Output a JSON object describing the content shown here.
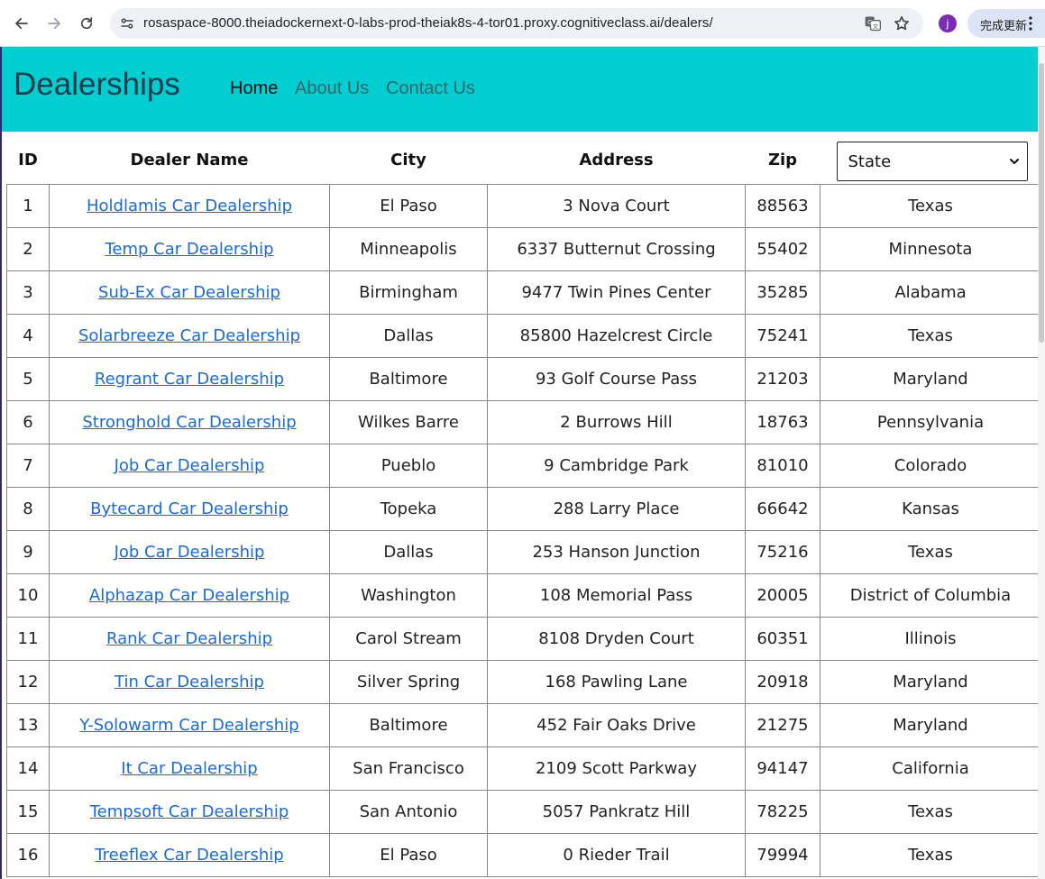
{
  "browser": {
    "url": "rosaspace-8000.theiadockernext-0-labs-prod-theiak8s-4-tor01.proxy.cognitiveclass.ai/dealers/",
    "profile_initial": "j",
    "update_label": "完成更新"
  },
  "navbar": {
    "brand": "Dealerships",
    "links": [
      {
        "label": "Home",
        "active": true
      },
      {
        "label": "About Us",
        "active": false
      },
      {
        "label": "Contact Us",
        "active": false
      }
    ],
    "background_color": "#00ced1"
  },
  "table": {
    "headers": {
      "id": "ID",
      "dealer_name": "Dealer Name",
      "city": "City",
      "address": "Address",
      "zip": "Zip"
    },
    "state_filter": {
      "selected": "State"
    },
    "rows": [
      {
        "id": "1",
        "name": "Holdlamis Car Dealership",
        "city": "El Paso",
        "address": "3 Nova Court",
        "zip": "88563",
        "state": "Texas"
      },
      {
        "id": "2",
        "name": "Temp Car Dealership",
        "city": "Minneapolis",
        "address": "6337 Butternut Crossing",
        "zip": "55402",
        "state": "Minnesota"
      },
      {
        "id": "3",
        "name": "Sub-Ex Car Dealership",
        "city": "Birmingham",
        "address": "9477 Twin Pines Center",
        "zip": "35285",
        "state": "Alabama"
      },
      {
        "id": "4",
        "name": "Solarbreeze Car Dealership",
        "city": "Dallas",
        "address": "85800 Hazelcrest Circle",
        "zip": "75241",
        "state": "Texas"
      },
      {
        "id": "5",
        "name": "Regrant Car Dealership",
        "city": "Baltimore",
        "address": "93 Golf Course Pass",
        "zip": "21203",
        "state": "Maryland"
      },
      {
        "id": "6",
        "name": "Stronghold Car Dealership",
        "city": "Wilkes Barre",
        "address": "2 Burrows Hill",
        "zip": "18763",
        "state": "Pennsylvania"
      },
      {
        "id": "7",
        "name": "Job Car Dealership",
        "city": "Pueblo",
        "address": "9 Cambridge Park",
        "zip": "81010",
        "state": "Colorado"
      },
      {
        "id": "8",
        "name": "Bytecard Car Dealership",
        "city": "Topeka",
        "address": "288 Larry Place",
        "zip": "66642",
        "state": "Kansas"
      },
      {
        "id": "9",
        "name": "Job Car Dealership",
        "city": "Dallas",
        "address": "253 Hanson Junction",
        "zip": "75216",
        "state": "Texas"
      },
      {
        "id": "10",
        "name": "Alphazap Car Dealership",
        "city": "Washington",
        "address": "108 Memorial Pass",
        "zip": "20005",
        "state": "District of Columbia"
      },
      {
        "id": "11",
        "name": "Rank Car Dealership",
        "city": "Carol Stream",
        "address": "8108 Dryden Court",
        "zip": "60351",
        "state": "Illinois"
      },
      {
        "id": "12",
        "name": "Tin Car Dealership",
        "city": "Silver Spring",
        "address": "168 Pawling Lane",
        "zip": "20918",
        "state": "Maryland"
      },
      {
        "id": "13",
        "name": "Y-Solowarm Car Dealership",
        "city": "Baltimore",
        "address": "452 Fair Oaks Drive",
        "zip": "21275",
        "state": "Maryland"
      },
      {
        "id": "14",
        "name": "It Car Dealership",
        "city": "San Francisco",
        "address": "2109 Scott Parkway",
        "zip": "94147",
        "state": "California"
      },
      {
        "id": "15",
        "name": "Tempsoft Car Dealership",
        "city": "San Antonio",
        "address": "5057 Pankratz Hill",
        "zip": "78225",
        "state": "Texas"
      },
      {
        "id": "16",
        "name": "Treeflex Car Dealership",
        "city": "El Paso",
        "address": "0 Rieder Trail",
        "zip": "79994",
        "state": "Texas"
      }
    ]
  }
}
